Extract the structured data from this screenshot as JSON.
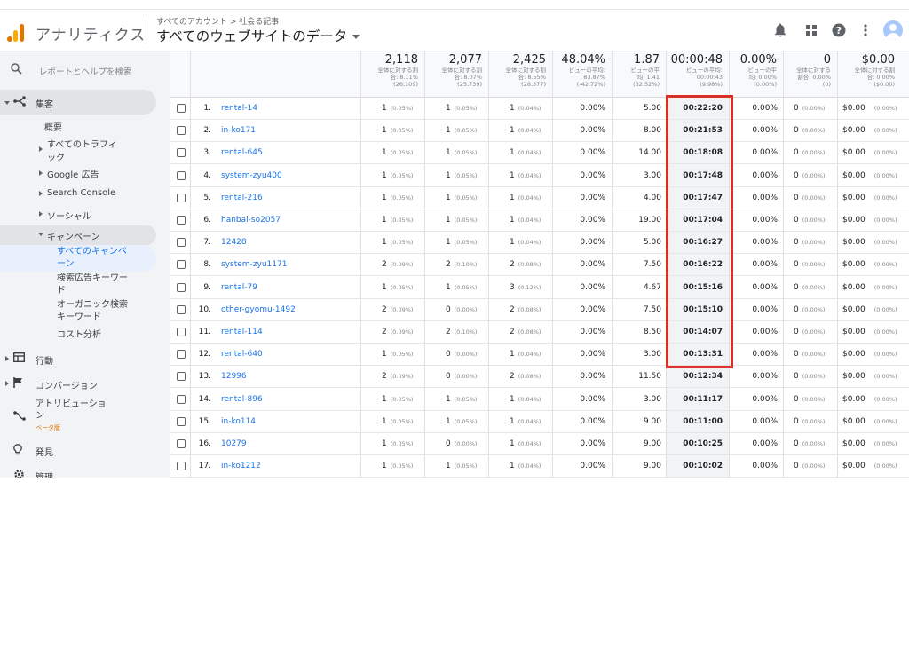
{
  "header": {
    "app_name": "アナリティクス",
    "breadcrumb": "すべてのアカウント > 社会る記事",
    "view": "すべてのウェブサイトのデータ",
    "icons": [
      "bell-icon",
      "apps-grid-icon",
      "help-icon",
      "more-vert-icon",
      "account-avatar"
    ]
  },
  "sidebar": {
    "search_placeholder": "レポートとヘルプを検索",
    "acquisition": "集客",
    "overview": "概要",
    "all_traffic_1": "すべてのトラフィ",
    "all_traffic_2": "ック",
    "google_ads": "Google 広告",
    "search_console": "Search Console",
    "social": "ソーシャル",
    "campaigns": "キャンペーン",
    "all_campaigns_1": "すべてのキャンペ",
    "all_campaigns_2": "ーン",
    "paid_keywords_1": "検索広告キーワー",
    "paid_keywords_2": "ド",
    "organic_keywords_1": "オーガニック検索",
    "organic_keywords_2": "キーワード",
    "cost_analysis": "コスト分析",
    "behavior": "行動",
    "conversions": "コンバージョン",
    "attribution_1": "アトリビューショ",
    "attribution_2": "ン",
    "beta": "ベータ版",
    "discover": "発見",
    "admin": "管理"
  },
  "totals": [
    {
      "big": "2,118",
      "l1": "全体に対する割",
      "l2": "合: 8.11%",
      "l3": "(26,109)"
    },
    {
      "big": "2,077",
      "l1": "全体に対する割",
      "l2": "合: 8.07%",
      "l3": "(25,739)"
    },
    {
      "big": "2,425",
      "l1": "全体に対する割",
      "l2": "合: 8.55%",
      "l3": "(28,377)"
    },
    {
      "big": "48.04%",
      "l1": "ビューの平均:",
      "l2": "83.87%",
      "l3": "(-42.72%)"
    },
    {
      "big": "1.87",
      "l1": "ビューの平",
      "l2": "均: 1.41",
      "l3": "(32.52%)"
    },
    {
      "big": "00:00:48",
      "l1": "ビューの平均:",
      "l2": "00:00:43",
      "l3": "(9.98%)"
    },
    {
      "big": "0.00%",
      "l1": "ビューの平",
      "l2": "均: 0.00%",
      "l3": "(0.00%)"
    },
    {
      "big": "0",
      "l1": "全体に対する",
      "l2": "割合: 0.00%",
      "l3": "(0)"
    },
    {
      "big": "$0.00",
      "l1": "全体に対する割",
      "l2": "合: 0.00%",
      "l3": "($0.00)"
    }
  ],
  "rows": [
    {
      "rank": "1.",
      "source": "rental-14",
      "users": "1",
      "users_pct": "(0.05%)",
      "new_users": "1",
      "new_users_pct": "(0.05%)",
      "sessions": "1",
      "sessions_pct": "(0.04%)",
      "bounce": "0.00%",
      "pages": "5.00",
      "duration": "00:22:20",
      "cvr": "0.00%",
      "goals": "0",
      "goals_pct": "(0.00%)",
      "value": "$0.00",
      "value_pct": "(0.00%)"
    },
    {
      "rank": "2.",
      "source": "in-ko171",
      "users": "1",
      "users_pct": "(0.05%)",
      "new_users": "1",
      "new_users_pct": "(0.05%)",
      "sessions": "1",
      "sessions_pct": "(0.04%)",
      "bounce": "0.00%",
      "pages": "8.00",
      "duration": "00:21:53",
      "cvr": "0.00%",
      "goals": "0",
      "goals_pct": "(0.00%)",
      "value": "$0.00",
      "value_pct": "(0.00%)"
    },
    {
      "rank": "3.",
      "source": "rental-645",
      "users": "1",
      "users_pct": "(0.05%)",
      "new_users": "1",
      "new_users_pct": "(0.05%)",
      "sessions": "1",
      "sessions_pct": "(0.04%)",
      "bounce": "0.00%",
      "pages": "14.00",
      "duration": "00:18:08",
      "cvr": "0.00%",
      "goals": "0",
      "goals_pct": "(0.00%)",
      "value": "$0.00",
      "value_pct": "(0.00%)"
    },
    {
      "rank": "4.",
      "source": "system-zyu400",
      "users": "1",
      "users_pct": "(0.05%)",
      "new_users": "1",
      "new_users_pct": "(0.05%)",
      "sessions": "1",
      "sessions_pct": "(0.04%)",
      "bounce": "0.00%",
      "pages": "3.00",
      "duration": "00:17:48",
      "cvr": "0.00%",
      "goals": "0",
      "goals_pct": "(0.00%)",
      "value": "$0.00",
      "value_pct": "(0.00%)"
    },
    {
      "rank": "5.",
      "source": "rental-216",
      "users": "1",
      "users_pct": "(0.05%)",
      "new_users": "1",
      "new_users_pct": "(0.05%)",
      "sessions": "1",
      "sessions_pct": "(0.04%)",
      "bounce": "0.00%",
      "pages": "4.00",
      "duration": "00:17:47",
      "cvr": "0.00%",
      "goals": "0",
      "goals_pct": "(0.00%)",
      "value": "$0.00",
      "value_pct": "(0.00%)"
    },
    {
      "rank": "6.",
      "source": "hanbai-so2057",
      "users": "1",
      "users_pct": "(0.05%)",
      "new_users": "1",
      "new_users_pct": "(0.05%)",
      "sessions": "1",
      "sessions_pct": "(0.04%)",
      "bounce": "0.00%",
      "pages": "19.00",
      "duration": "00:17:04",
      "cvr": "0.00%",
      "goals": "0",
      "goals_pct": "(0.00%)",
      "value": "$0.00",
      "value_pct": "(0.00%)"
    },
    {
      "rank": "7.",
      "source": "12428",
      "users": "1",
      "users_pct": "(0.05%)",
      "new_users": "1",
      "new_users_pct": "(0.05%)",
      "sessions": "1",
      "sessions_pct": "(0.04%)",
      "bounce": "0.00%",
      "pages": "5.00",
      "duration": "00:16:27",
      "cvr": "0.00%",
      "goals": "0",
      "goals_pct": "(0.00%)",
      "value": "$0.00",
      "value_pct": "(0.00%)"
    },
    {
      "rank": "8.",
      "source": "system-zyu1171",
      "users": "2",
      "users_pct": "(0.09%)",
      "new_users": "2",
      "new_users_pct": "(0.10%)",
      "sessions": "2",
      "sessions_pct": "(0.08%)",
      "bounce": "0.00%",
      "pages": "7.50",
      "duration": "00:16:22",
      "cvr": "0.00%",
      "goals": "0",
      "goals_pct": "(0.00%)",
      "value": "$0.00",
      "value_pct": "(0.00%)"
    },
    {
      "rank": "9.",
      "source": "rental-79",
      "users": "1",
      "users_pct": "(0.05%)",
      "new_users": "1",
      "new_users_pct": "(0.05%)",
      "sessions": "3",
      "sessions_pct": "(0.12%)",
      "bounce": "0.00%",
      "pages": "4.67",
      "duration": "00:15:16",
      "cvr": "0.00%",
      "goals": "0",
      "goals_pct": "(0.00%)",
      "value": "$0.00",
      "value_pct": "(0.00%)"
    },
    {
      "rank": "10.",
      "source": "other-gyomu-1492",
      "users": "2",
      "users_pct": "(0.09%)",
      "new_users": "0",
      "new_users_pct": "(0.00%)",
      "sessions": "2",
      "sessions_pct": "(0.08%)",
      "bounce": "0.00%",
      "pages": "7.50",
      "duration": "00:15:10",
      "cvr": "0.00%",
      "goals": "0",
      "goals_pct": "(0.00%)",
      "value": "$0.00",
      "value_pct": "(0.00%)"
    },
    {
      "rank": "11.",
      "source": "rental-114",
      "users": "2",
      "users_pct": "(0.09%)",
      "new_users": "2",
      "new_users_pct": "(0.10%)",
      "sessions": "2",
      "sessions_pct": "(0.08%)",
      "bounce": "0.00%",
      "pages": "8.50",
      "duration": "00:14:07",
      "cvr": "0.00%",
      "goals": "0",
      "goals_pct": "(0.00%)",
      "value": "$0.00",
      "value_pct": "(0.00%)"
    },
    {
      "rank": "12.",
      "source": "rental-640",
      "users": "1",
      "users_pct": "(0.05%)",
      "new_users": "0",
      "new_users_pct": "(0.00%)",
      "sessions": "1",
      "sessions_pct": "(0.04%)",
      "bounce": "0.00%",
      "pages": "3.00",
      "duration": "00:13:31",
      "cvr": "0.00%",
      "goals": "0",
      "goals_pct": "(0.00%)",
      "value": "$0.00",
      "value_pct": "(0.00%)"
    },
    {
      "rank": "13.",
      "source": "12996",
      "users": "2",
      "users_pct": "(0.09%)",
      "new_users": "0",
      "new_users_pct": "(0.00%)",
      "sessions": "2",
      "sessions_pct": "(0.08%)",
      "bounce": "0.00%",
      "pages": "11.50",
      "duration": "00:12:34",
      "cvr": "0.00%",
      "goals": "0",
      "goals_pct": "(0.00%)",
      "value": "$0.00",
      "value_pct": "(0.00%)"
    },
    {
      "rank": "14.",
      "source": "rental-896",
      "users": "1",
      "users_pct": "(0.05%)",
      "new_users": "1",
      "new_users_pct": "(0.05%)",
      "sessions": "1",
      "sessions_pct": "(0.04%)",
      "bounce": "0.00%",
      "pages": "3.00",
      "duration": "00:11:17",
      "cvr": "0.00%",
      "goals": "0",
      "goals_pct": "(0.00%)",
      "value": "$0.00",
      "value_pct": "(0.00%)"
    },
    {
      "rank": "15.",
      "source": "in-ko114",
      "users": "1",
      "users_pct": "(0.05%)",
      "new_users": "1",
      "new_users_pct": "(0.05%)",
      "sessions": "1",
      "sessions_pct": "(0.04%)",
      "bounce": "0.00%",
      "pages": "9.00",
      "duration": "00:11:00",
      "cvr": "0.00%",
      "goals": "0",
      "goals_pct": "(0.00%)",
      "value": "$0.00",
      "value_pct": "(0.00%)"
    },
    {
      "rank": "16.",
      "source": "10279",
      "users": "1",
      "users_pct": "(0.05%)",
      "new_users": "0",
      "new_users_pct": "(0.00%)",
      "sessions": "1",
      "sessions_pct": "(0.04%)",
      "bounce": "0.00%",
      "pages": "9.00",
      "duration": "00:10:25",
      "cvr": "0.00%",
      "goals": "0",
      "goals_pct": "(0.00%)",
      "value": "$0.00",
      "value_pct": "(0.00%)"
    },
    {
      "rank": "17.",
      "source": "in-ko1212",
      "users": "1",
      "users_pct": "(0.05%)",
      "new_users": "1",
      "new_users_pct": "(0.05%)",
      "sessions": "1",
      "sessions_pct": "(0.04%)",
      "bounce": "0.00%",
      "pages": "9.00",
      "duration": "00:10:02",
      "cvr": "0.00%",
      "goals": "0",
      "goals_pct": "(0.00%)",
      "value": "$0.00",
      "value_pct": "(0.00%)"
    }
  ],
  "colors": {
    "link": "#1a73e8",
    "highlight_box": "#d93025",
    "brand_orange": "#e37400",
    "brand_yellow": "#f9ab00"
  }
}
